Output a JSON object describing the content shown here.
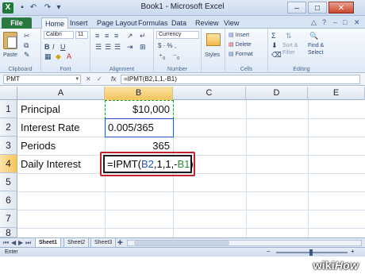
{
  "window": {
    "title": "Book1 - Microsoft Excel",
    "minimize": "–",
    "maximize": "□",
    "close": "✕"
  },
  "ribbon_tabs": [
    "File",
    "Home",
    "Insert",
    "Page Layout",
    "Formulas",
    "Data",
    "Review",
    "View"
  ],
  "ribbon": {
    "clipboard": {
      "paste": "Paste",
      "label": "Clipboard"
    },
    "font": {
      "name": "Calibri",
      "size": "11",
      "label": "Font"
    },
    "alignment": {
      "label": "Alignment"
    },
    "number": {
      "format": "Currency",
      "symbol": "$ · % ,",
      "label": "Number"
    },
    "styles": {
      "label": "Styles"
    },
    "cells": {
      "insert": "Insert",
      "delete": "Delete",
      "format": "Format",
      "label": "Cells"
    },
    "editing": {
      "sort": "Sort &",
      "filter": "Filter",
      "find": "Find &",
      "select": "Select",
      "label": "Editing"
    }
  },
  "formula_bar": {
    "name_box": "PMT",
    "cancel": "✕",
    "enter": "✓",
    "fx": "fx",
    "formula": "=IPMT(B2,1,1,-B1)"
  },
  "columns": [
    "A",
    "B",
    "C",
    "D",
    "E"
  ],
  "rows": [
    "1",
    "2",
    "3",
    "4",
    "5",
    "6",
    "7",
    "8"
  ],
  "cells": {
    "A1": "Principal",
    "B1": "$10,000",
    "A2": "Interest Rate",
    "B2": "0.005/365",
    "A3": "Periods",
    "B3": "365",
    "A4": "Daily Interest",
    "B4": {
      "prefix": "=IPMT(",
      "ref1": "B2",
      "mid": ",1,1,-",
      "ref2": "B1",
      "suffix": ")"
    }
  },
  "sheets": [
    "Sheet1",
    "Sheet2",
    "Sheet3"
  ],
  "status": {
    "mode": "Enter"
  },
  "watermark": {
    "wiki": "wiki",
    "how": "How"
  },
  "colors": {
    "excel_green": "#1f7a3a",
    "highlight_red": "#c0242c",
    "ref_blue": "#2456c4",
    "ref_green": "#23903a"
  }
}
